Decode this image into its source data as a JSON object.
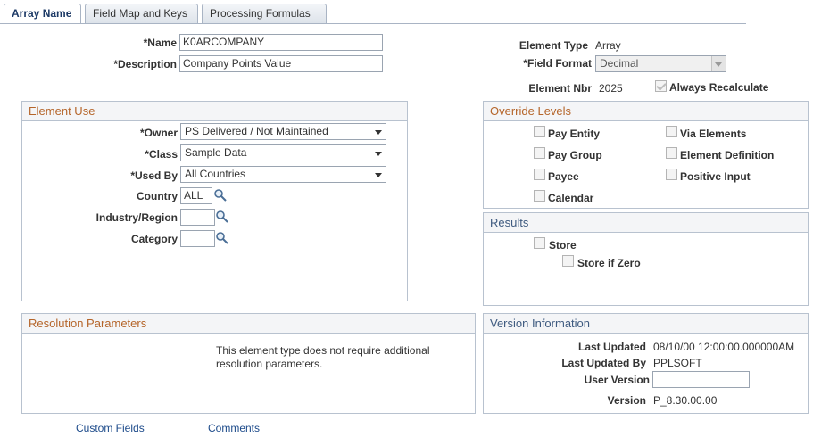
{
  "tabs": [
    {
      "label": "Array Name",
      "active": true
    },
    {
      "label": "Field Map and Keys",
      "active": false
    },
    {
      "label": "Processing Formulas",
      "active": false
    }
  ],
  "header": {
    "name_label": "*Name",
    "name_value": "K0ARCOMPANY",
    "description_label": "*Description",
    "description_value": "Company Points Value",
    "element_type_label": "Element Type",
    "element_type_value": "Array",
    "field_format_label": "*Field Format",
    "field_format_value": "Decimal",
    "element_nbr_label": "Element Nbr",
    "element_nbr_value": "2025",
    "always_recalculate_label": "Always Recalculate",
    "always_recalculate_checked": true
  },
  "element_use": {
    "title": "Element Use",
    "owner_label": "*Owner",
    "owner_value": "PS Delivered / Not Maintained",
    "class_label": "*Class",
    "class_value": "Sample Data",
    "used_by_label": "*Used By",
    "used_by_value": "All Countries",
    "country_label": "Country",
    "country_value": "ALL",
    "industry_label": "Industry/Region",
    "industry_value": "",
    "category_label": "Category",
    "category_value": ""
  },
  "override_levels": {
    "title": "Override Levels",
    "items": [
      {
        "label": "Pay Entity",
        "checked": false
      },
      {
        "label": "Via Elements",
        "checked": false
      },
      {
        "label": "Pay Group",
        "checked": false
      },
      {
        "label": "Element Definition",
        "checked": false
      },
      {
        "label": "Payee",
        "checked": false
      },
      {
        "label": "Positive Input",
        "checked": false
      },
      {
        "label": "Calendar",
        "checked": false
      }
    ]
  },
  "results": {
    "title": "Results",
    "store_label": "Store",
    "store_if_zero_label": "Store if Zero"
  },
  "resolution": {
    "title": "Resolution Parameters",
    "line1": "This element type does not require additional",
    "line2": "resolution parameters."
  },
  "version": {
    "title": "Version Information",
    "last_updated_label": "Last Updated",
    "last_updated_value": "08/10/00 12:00:00.000000AM",
    "last_updated_by_label": "Last Updated By",
    "last_updated_by_value": "PPLSOFT",
    "user_version_label": "User Version",
    "user_version_value": "",
    "version_label": "Version",
    "version_value": "P_8.30.00.00"
  },
  "links": {
    "custom_fields": "Custom Fields",
    "comments": "Comments"
  },
  "colors": {
    "group_title_orange": "#b5652a",
    "group_title_blue": "#3f5b80",
    "link_blue": "#1c4a8a"
  }
}
